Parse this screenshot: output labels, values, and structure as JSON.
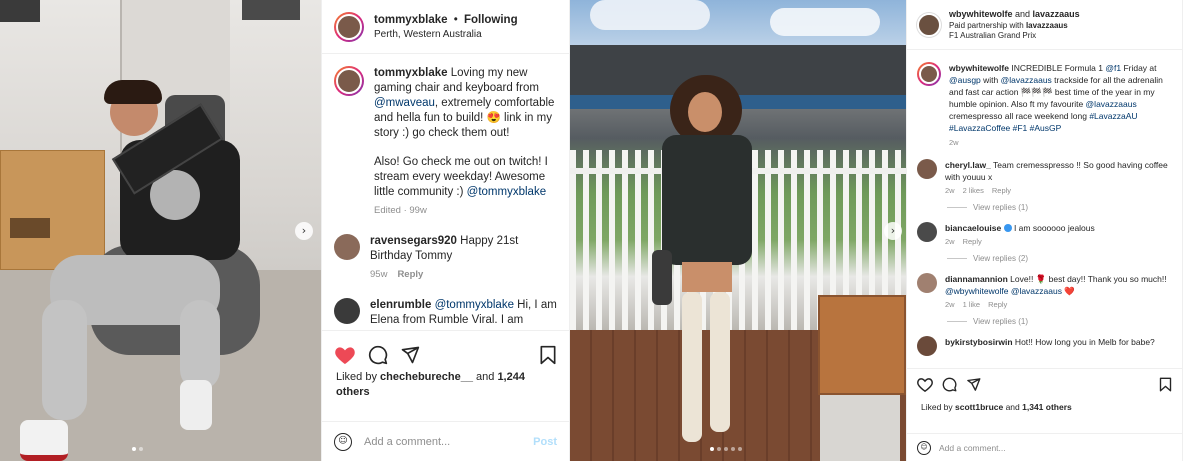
{
  "post1": {
    "username": "tommyxblake",
    "following": "Following",
    "location": "Perth, Western Australia",
    "caption": {
      "text_a": "Loving my new gaming chair and keyboard from ",
      "mention_a": "@mwaveau",
      "text_b": ", extremely comfortable and hella fun to build! 😍 link in my story :) go check them out!",
      "text_c": "Also! Go check me out on twitch! I stream every weekday! Awesome little community :) ",
      "mention_b": "@tommyxblake",
      "edited": "Edited · 99w"
    },
    "comments": [
      {
        "username": "ravensegars920",
        "text": "Happy 21st Birthday Tommy",
        "time": "95w",
        "reply": "Reply"
      },
      {
        "username": "elenrumble",
        "mention": "@tommyxblake",
        "text": " Hi, I am Elena from Rumble Viral. I am"
      }
    ],
    "likes": {
      "prefix": "Liked by ",
      "user": "chechebureche__",
      "suffix": " and ",
      "count": "1,244 others"
    },
    "add_comment_placeholder": "Add a comment...",
    "post_label": "Post",
    "icons": {
      "like": "heart-filled-icon",
      "comment": "comment-icon",
      "share": "share-icon",
      "save": "bookmark-icon"
    },
    "colors": {
      "heart": "#ed4956",
      "link": "#00376b",
      "post": "#b2dffb"
    }
  },
  "post2": {
    "header_user_a": "wbywhitewolfe",
    "header_and": " and ",
    "header_user_b": "lavazzaaus",
    "paid": "Paid partnership with ",
    "paid_user": "lavazzaaus",
    "location": "F1 Australian Grand Prix",
    "caption": {
      "username": "wbywhitewolfe",
      "t1": " INCREDIBLE Formula 1 ",
      "m1": "@f1",
      "t2": " Friday at ",
      "m2": "@ausgp",
      "t3": " with ",
      "m3": "@lavazzaaus",
      "t4": " trackside for all the adrenalin and fast car action 🏁🏁🏁 best time of the year in my humble opinion. Also ft my favourite ",
      "m4": "@lavazzaaus",
      "t5": " cremespresso all race weekend long ",
      "tags": "#LavazzaAU #LavazzaCoffee #F1 #AusGP",
      "time": "2w"
    },
    "comments": [
      {
        "username": "cheryl.law_",
        "text": " Team cremesspresso !! So good having coffee with youuu x",
        "time": "2w",
        "likes": "2 likes",
        "reply": "Reply",
        "view_replies": "View replies (1)"
      },
      {
        "username": "biancaelouise",
        "text": " I am soooooo jealous",
        "time": "2w",
        "reply": "Reply",
        "view_replies": "View replies (2)"
      },
      {
        "username": "diannamannion",
        "text": " Love!! 🌹 best day!! Thank you so much!! ",
        "mention_a": "@wbywhitewolfe",
        "mention_b": "@lavazzaaus",
        "heart": "❤️",
        "time": "2w",
        "likes": "1 like",
        "reply": "Reply",
        "view_replies": "View replies (1)"
      },
      {
        "username": "bykirstybosirwin",
        "text": " Hot!! How long you in Melb for babe?"
      }
    ],
    "likes": {
      "prefix": "Liked by ",
      "user": "scott1bruce",
      "suffix": " and ",
      "count": "1,341 others"
    },
    "add_comment_placeholder": "Add a comment...",
    "icons": {
      "like": "heart-outline-icon",
      "comment": "comment-icon",
      "share": "share-icon",
      "save": "bookmark-icon"
    }
  }
}
